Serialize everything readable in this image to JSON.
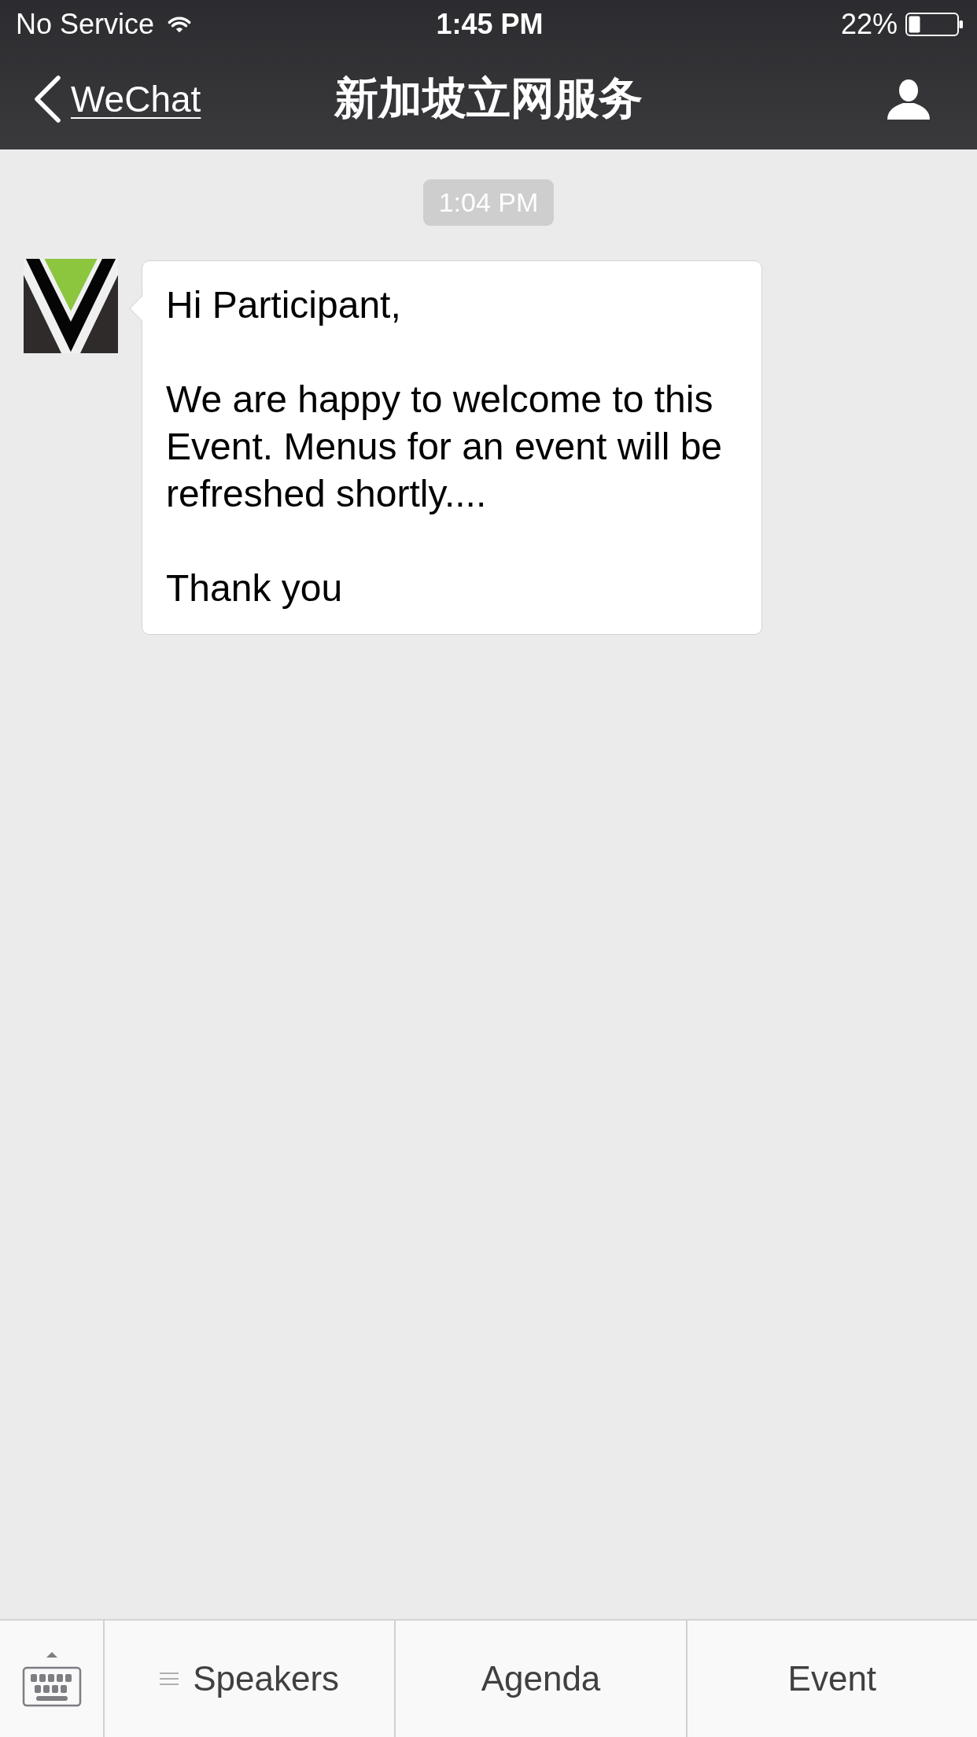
{
  "status_bar": {
    "carrier": "No Service",
    "time": "1:45 PM",
    "battery": "22%"
  },
  "nav_bar": {
    "back_label": "WeChat",
    "title": "新加坡立网服务"
  },
  "chat": {
    "timestamp": "1:04 PM",
    "messages": [
      {
        "kind": "received",
        "paragraphs": [
          "Hi Participant,",
          "We are happy to welcome to this Event. Menus for an event will be refreshed shortly....",
          "Thank you"
        ]
      }
    ]
  },
  "menu_bar": {
    "items": [
      {
        "label": "Speakers",
        "submenu": true
      },
      {
        "label": "Agenda",
        "submenu": false
      },
      {
        "label": "Event",
        "submenu": false
      }
    ]
  }
}
